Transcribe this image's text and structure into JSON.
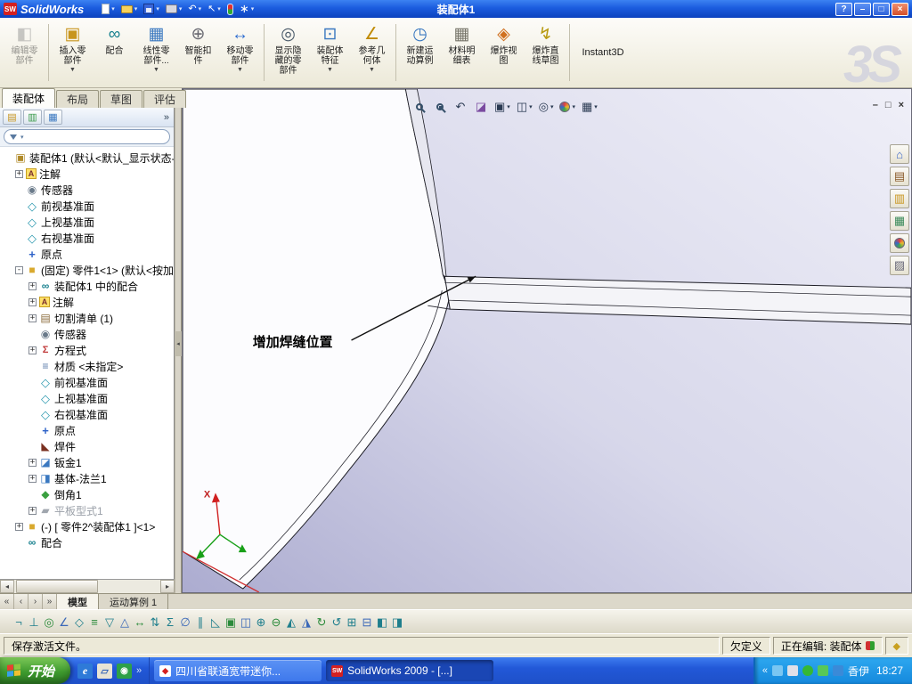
{
  "titlebar": {
    "brand": "SolidWorks",
    "logo": "SW",
    "title": "装配体1",
    "help": "?",
    "controls": {
      "min": "–",
      "max": "□",
      "close": "×"
    },
    "quickbar_icons": [
      "new-document",
      "open",
      "save",
      "print",
      "undo",
      "select",
      "rebuild",
      "options"
    ]
  },
  "toolbar": {
    "watermark": "3S",
    "buttons": [
      {
        "label": "编辑零\n部件",
        "disabled": true,
        "dd": false
      },
      {
        "label": "插入零\n部件",
        "disabled": false,
        "dd": true
      },
      {
        "label": "配合",
        "disabled": false,
        "dd": false
      },
      {
        "label": "线性零\n部件...",
        "disabled": false,
        "dd": true
      },
      {
        "label": "智能扣\n件",
        "disabled": false,
        "dd": false
      },
      {
        "label": "移动零\n部件",
        "disabled": false,
        "dd": true
      },
      {
        "label": "显示隐\n藏的零\n部件",
        "disabled": false,
        "dd": false
      },
      {
        "label": "装配体\n特征",
        "disabled": false,
        "dd": true
      },
      {
        "label": "参考几\n何体",
        "disabled": false,
        "dd": true
      },
      {
        "label": "新建运\n动算例",
        "disabled": false,
        "dd": false
      },
      {
        "label": "材料明\n细表",
        "disabled": false,
        "dd": false
      },
      {
        "label": "爆炸视\n图",
        "disabled": false,
        "dd": false
      },
      {
        "label": "爆炸直\n线草图",
        "disabled": false,
        "dd": false
      },
      {
        "label": "Instant3D",
        "disabled": false,
        "dd": false
      }
    ]
  },
  "cmd_tabs": [
    {
      "label": "装配体",
      "active": true
    },
    {
      "label": "布局",
      "active": false
    },
    {
      "label": "草图",
      "active": false
    },
    {
      "label": "评估",
      "active": false
    }
  ],
  "panel": {
    "tabs": [
      "featuremanager",
      "propertymanager",
      "configurationmanager"
    ],
    "chevron": "»",
    "filter": {
      "placeholder": "",
      "value": ""
    },
    "tree": [
      {
        "label": "装配体1 (默认<默认_显示状态-",
        "icon": "assembly",
        "level": 0,
        "expand": ""
      },
      {
        "label": "注解",
        "icon": "annotations",
        "level": 1,
        "expand": "+"
      },
      {
        "label": "传感器",
        "icon": "sensors",
        "level": 1,
        "expand": ""
      },
      {
        "label": "前视基准面",
        "icon": "plane",
        "level": 1,
        "expand": ""
      },
      {
        "label": "上视基准面",
        "icon": "plane",
        "level": 1,
        "expand": ""
      },
      {
        "label": "右视基准面",
        "icon": "plane",
        "level": 1,
        "expand": ""
      },
      {
        "label": "原点",
        "icon": "origin",
        "level": 1,
        "expand": ""
      },
      {
        "label": "(固定) 零件1<1> (默认<按加",
        "icon": "part",
        "level": 1,
        "expand": "-"
      },
      {
        "label": "装配体1 中的配合",
        "icon": "mates-folder",
        "level": 2,
        "expand": "+"
      },
      {
        "label": "注解",
        "icon": "annotations",
        "level": 2,
        "expand": "+"
      },
      {
        "label": "切割清单 (1)",
        "icon": "cut-list",
        "level": 2,
        "expand": "+"
      },
      {
        "label": "传感器",
        "icon": "sensors",
        "level": 2,
        "expand": ""
      },
      {
        "label": "方程式",
        "icon": "equations",
        "level": 2,
        "expand": "+"
      },
      {
        "label": "材质 <未指定>",
        "icon": "material",
        "level": 2,
        "expand": ""
      },
      {
        "label": "前视基准面",
        "icon": "plane",
        "level": 2,
        "expand": ""
      },
      {
        "label": "上视基准面",
        "icon": "plane",
        "level": 2,
        "expand": ""
      },
      {
        "label": "右视基准面",
        "icon": "plane",
        "level": 2,
        "expand": ""
      },
      {
        "label": "原点",
        "icon": "origin",
        "level": 2,
        "expand": ""
      },
      {
        "label": "焊件",
        "icon": "weldment",
        "level": 2,
        "expand": ""
      },
      {
        "label": "钣金1",
        "icon": "sheet-metal",
        "level": 2,
        "expand": "+"
      },
      {
        "label": "基体-法兰1",
        "icon": "base-flange",
        "level": 2,
        "expand": "+"
      },
      {
        "label": "倒角1",
        "icon": "chamfer",
        "level": 2,
        "expand": ""
      },
      {
        "label": "平板型式1",
        "icon": "flat-pattern",
        "level": 2,
        "expand": "+",
        "grayed": true
      },
      {
        "label": "(-) [ 零件2^装配体1 ]<1>",
        "icon": "part",
        "level": 1,
        "expand": "+"
      },
      {
        "label": "配合",
        "icon": "mates",
        "level": 1,
        "expand": ""
      }
    ]
  },
  "viewport": {
    "annotation": "增加焊缝位置",
    "triad_x_label": "X",
    "headsup_icons": [
      "zoom-fit",
      "zoom-to-area",
      "previous-view",
      "section-view",
      "view-orientation",
      "display-style",
      "hide-show-items",
      "edit-appearance",
      "apply-scene"
    ],
    "doc_controls": {
      "min": "–",
      "restore": "□",
      "close": "×"
    },
    "taskpane_icons": [
      "solidworks-resources-home",
      "design-library",
      "file-explorer",
      "view-palette",
      "appearances",
      "custom-properties"
    ]
  },
  "bottom_tabs": {
    "nav": [
      "«",
      "‹",
      "›",
      "»"
    ],
    "tabs": [
      {
        "label": "模型",
        "active": true
      },
      {
        "label": "运动算例 1",
        "active": false
      }
    ]
  },
  "bottom_toolbar": {
    "icons": [
      "¬",
      "⊥",
      "◎",
      "∠",
      "◇",
      "≡",
      "▽",
      "△",
      "↔",
      "⇅",
      "Σ",
      "∅",
      "∥",
      "◺",
      "▣",
      "◫",
      "⊕",
      "⊖",
      "◭",
      "◮",
      "↻",
      "↺",
      "⊞",
      "⊟",
      "◧",
      "◨"
    ]
  },
  "statusbar": {
    "message": "保存激活文件。",
    "state": "欠定义",
    "editing": "正在编辑: 装配体"
  },
  "taskbar": {
    "start": "开始",
    "quick_launch": [
      "internet-explorer",
      "show-desktop",
      "media-player"
    ],
    "tasks": [
      {
        "label": "四川省联通宽带迷你...",
        "active": false
      },
      {
        "label": "SolidWorks 2009 - [...]",
        "active": true
      }
    ],
    "tray": {
      "lang": "香伊",
      "time": "18:27"
    }
  }
}
